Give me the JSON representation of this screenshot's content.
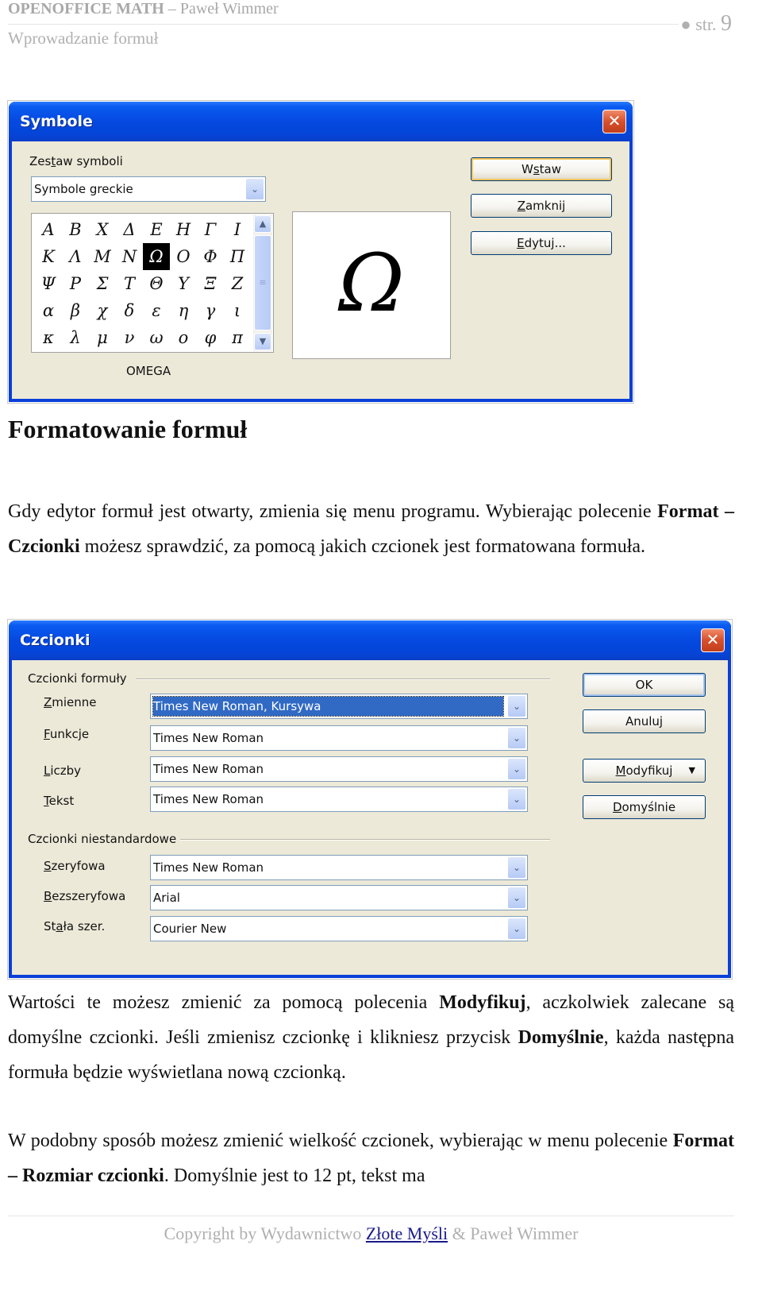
{
  "header": {
    "book_title": "OPENOFFICE MATH",
    "separator": " – ",
    "author": "Paweł Wimmer",
    "chapter": "Wprowadzanie formuł",
    "page_prefix": "● str. ",
    "page_number": "9"
  },
  "symbols_dialog": {
    "title": "Symbole",
    "close_glyph": "✕",
    "set_label": "Zestaw symboli",
    "set_value": "Symbole greckie",
    "dropdown_glyph": "⌄",
    "symbols": [
      "A",
      "B",
      "X",
      "Δ",
      "E",
      "H",
      "Γ",
      "I",
      "K",
      "Λ",
      "M",
      "N",
      "Ω",
      "O",
      "Φ",
      "Π",
      "Ψ",
      "P",
      "Σ",
      "T",
      "Θ",
      "Υ",
      "Ξ",
      "Z",
      "α",
      "β",
      "χ",
      "δ",
      "ε",
      "η",
      "γ",
      "ι",
      "κ",
      "λ",
      "μ",
      "ν",
      "ω",
      "ο",
      "φ",
      "π"
    ],
    "selected_symbol": "Ω",
    "selected_name": "OMEGA",
    "scroll_up_glyph": "▲",
    "scroll_down_glyph": "▼",
    "scroll_grip_glyph": "≡",
    "buttons": {
      "insert": "Wstaw",
      "close": "Zamknij",
      "edit": "Edytuj..."
    }
  },
  "heading": "Formatowanie formuł",
  "paragraph1": {
    "t1": "Gdy edytor formuł jest otwarty, zmienia się menu programu. Wybierając polecenie ",
    "b1": "Format – Czcionki",
    "t2": " możesz sprawdzić, za pomocą jakich czcionek jest formatowana formuła."
  },
  "fonts_dialog": {
    "title": "Czcionki",
    "close_glyph": "✕",
    "group1_label": "Czcionki formuły",
    "group2_label": "Czcionki niestandardowe",
    "rows1": [
      {
        "label": "Zmienne",
        "value": "Times New Roman, Kursywa"
      },
      {
        "label": "Funkcje",
        "value": "Times New Roman"
      },
      {
        "label": "Liczby",
        "value": "Times New Roman"
      },
      {
        "label": "Tekst",
        "value": "Times New Roman"
      }
    ],
    "rows2": [
      {
        "label": "Szeryfowa",
        "value": "Times New Roman"
      },
      {
        "label": "Bezszeryfowa",
        "value": "Arial"
      },
      {
        "label": "Stała szer.",
        "value": "Courier New"
      }
    ],
    "dropdown_glyph": "⌄",
    "buttons": {
      "ok": "OK",
      "cancel": "Anuluj",
      "modify": "Modyfikuj",
      "modify_caret": "▼",
      "default": "Domyślnie"
    }
  },
  "paragraph2": {
    "t1": "Wartości te możesz zmienić za pomocą polecenia ",
    "b1": "Modyfikuj",
    "t2": ", aczkolwiek zalecane są domyślne czcionki. Jeśli zmienisz czcionkę i klikniesz przycisk ",
    "b2": "Domyślnie",
    "t3": ", każda następna formuła będzie wyświetlana nową czcionką."
  },
  "paragraph3": {
    "t1": "W podobny sposób możesz zmienić wielkość czcionek, wybierając w menu polecenie ",
    "b1": "Format – Rozmiar czcionki",
    "t2": ". Domyślnie jest to 12 pt, tekst ma"
  },
  "footer": {
    "t1": "Copyright by Wydawnictwo ",
    "link": "Złote Myśli",
    "t2": " & Paweł Wimmer"
  }
}
